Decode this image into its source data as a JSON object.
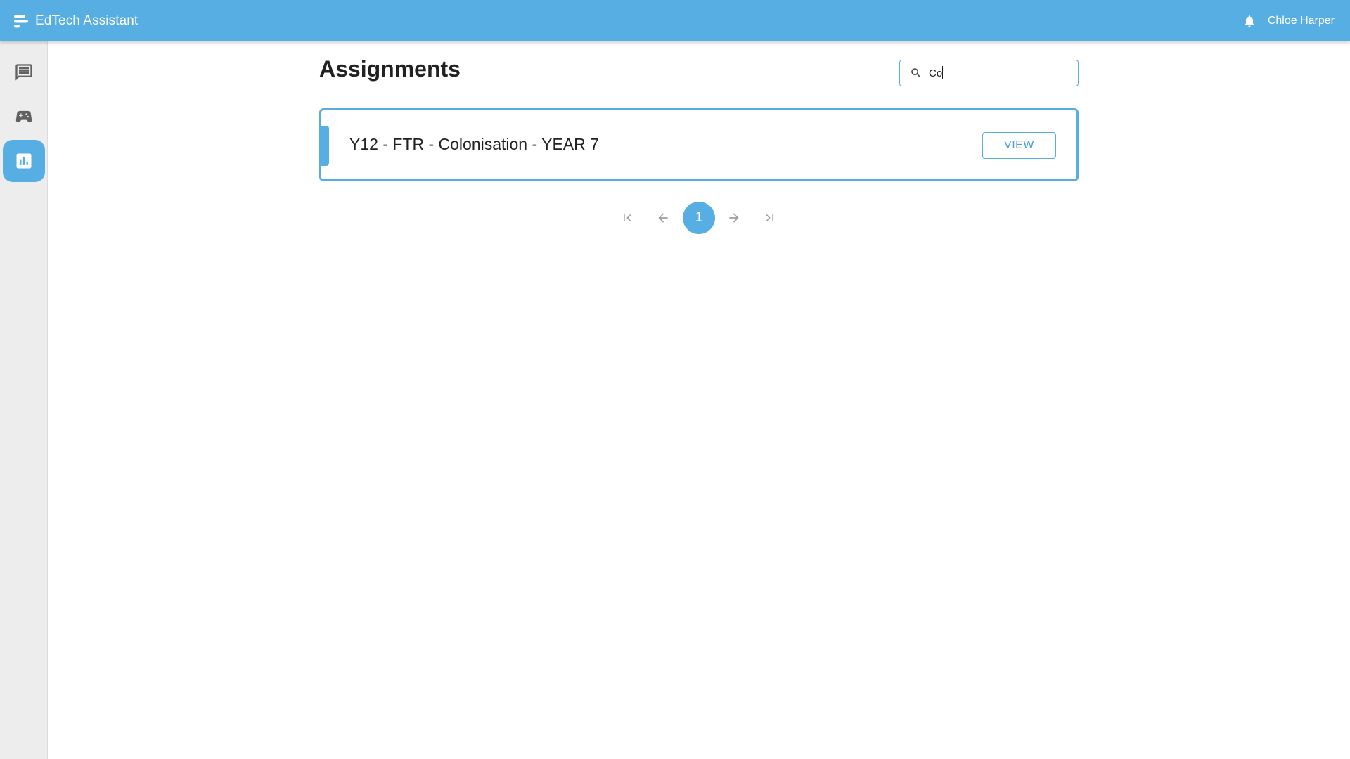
{
  "app": {
    "title": "EdTech Assistant"
  },
  "header": {
    "user_name": "Chloe Harper",
    "icons": [
      "menu-bars-icon",
      "bell-icon"
    ]
  },
  "sidebar": {
    "items": [
      {
        "icon": "chat-icon",
        "active": false
      },
      {
        "icon": "gamepad-icon",
        "active": false
      },
      {
        "icon": "bar-chart-icon",
        "active": true
      }
    ]
  },
  "main": {
    "title": "Assignments",
    "search": {
      "value": "Co",
      "placeholder": ""
    },
    "assignments": [
      {
        "title": "Y12 - FTR - Colonisation - YEAR 7",
        "action_label": "VIEW"
      }
    ],
    "pagination": {
      "current_page": "1",
      "controls": [
        "first-page-icon",
        "prev-page-icon",
        "next-page-icon",
        "last-page-icon"
      ]
    }
  },
  "colors": {
    "accent": "#56aee2",
    "rail_background": "#ededed",
    "text": "#212121"
  }
}
